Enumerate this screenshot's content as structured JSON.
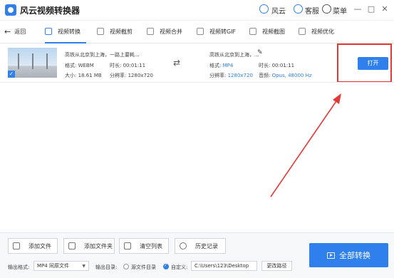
{
  "app": {
    "title": "风云视频转换器"
  },
  "titlebar": {
    "account": "风云",
    "service": "客服",
    "menu": "菜单",
    "minimize": "—",
    "maximize": "□",
    "close": "✕"
  },
  "nav": {
    "back": "返回",
    "tabs": [
      {
        "label": "视频转换",
        "active": true
      },
      {
        "label": "视频截剪"
      },
      {
        "label": "视频合并"
      },
      {
        "label": "视频转GIF"
      },
      {
        "label": "视频截图"
      },
      {
        "label": "视频优化"
      }
    ]
  },
  "file": {
    "source": {
      "name": "高铁从北京到上海，一路上要耗...",
      "format": "格式: WEBM",
      "duration": "时长: 00:01:11",
      "size": "大小: 18.61 MB",
      "resolution": "分辨率: 1280x720"
    },
    "output": {
      "name": "高铁从北京到上海，...",
      "format_label": "格式:",
      "format_value": "MP4",
      "duration": "时长: 00:01:11",
      "resolution_label": "分辨率:",
      "resolution_value": "1280x720",
      "audio_label": "音频:",
      "audio_value": "Opus, 48000 Hz"
    },
    "open_button": "打开"
  },
  "toolbar": {
    "add_file": "添加文件",
    "add_folder": "添加文件夹",
    "clear_list": "清空列表",
    "history": "历史记录"
  },
  "settings": {
    "output_format_label": "输出格式:",
    "output_format_value": "MP4 同原文件",
    "output_dir_label": "输出目录:",
    "source_dir_option": "源文件目录",
    "custom_option": "自定义:",
    "custom_path": "C:\\Users\\123\\Desktop",
    "change_path": "更改路径"
  },
  "convert_all": "全部转换",
  "colors": {
    "accent": "#2f80ed",
    "annotation": "#e53935"
  }
}
